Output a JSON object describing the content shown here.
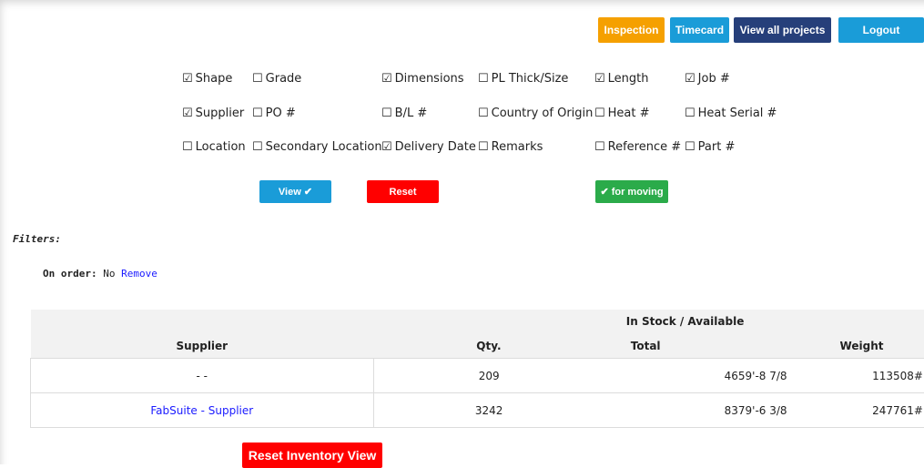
{
  "header": {
    "inspection": "Inspection",
    "timecard": "Timecard",
    "view_all_projects": "View all projects",
    "logout": "Logout"
  },
  "columns": {
    "row1": [
      {
        "label": "Shape",
        "checked": true
      },
      {
        "label": "Grade",
        "checked": false
      },
      {
        "label": "Dimensions",
        "checked": true
      },
      {
        "label": "PL Thick/Size",
        "checked": false
      },
      {
        "label": "Length",
        "checked": true
      },
      {
        "label": "Job #",
        "checked": true
      }
    ],
    "row2": [
      {
        "label": "Supplier",
        "checked": true
      },
      {
        "label": "PO #",
        "checked": false
      },
      {
        "label": "B/L #",
        "checked": false
      },
      {
        "label": "Country of Origin",
        "checked": false
      },
      {
        "label": "Heat #",
        "checked": false
      },
      {
        "label": "Heat Serial #",
        "checked": false
      }
    ],
    "row3": [
      {
        "label": "Location",
        "checked": false
      },
      {
        "label": "Secondary Location",
        "checked": false
      },
      {
        "label": "Delivery Date",
        "checked": true
      },
      {
        "label": "Remarks",
        "checked": false
      },
      {
        "label": "Reference #",
        "checked": false
      },
      {
        "label": "Part #",
        "checked": false
      }
    ]
  },
  "actions": {
    "view": "View ✔",
    "reset": "Reset",
    "moving": "✔ for moving"
  },
  "filters": {
    "title": "Filters:",
    "on_order_label": "On order:",
    "on_order_value": "No",
    "remove": "Remove"
  },
  "table": {
    "group_header": "In Stock / Available",
    "headers": [
      "Supplier",
      "Qty.",
      "Total",
      "Weight"
    ],
    "rows": [
      {
        "supplier": "- -",
        "qty": "209",
        "total": "4659'-8 7/8",
        "weight": "113508#"
      },
      {
        "supplier": "FabSuite - Supplier",
        "qty": "3242",
        "total": "8379'-6 3/8",
        "weight": "247761#"
      }
    ]
  },
  "reset_inventory": "Reset Inventory View",
  "colors": {
    "inspection": "#f5a000",
    "timecard": "#1a9cd8",
    "view_all": "#263f7a",
    "logout": "#1a9cd8",
    "view_btn": "#1a9cd8",
    "reset_btn": "#ff0000",
    "moving_btn": "#2bab4a",
    "link": "#1a1aff"
  }
}
